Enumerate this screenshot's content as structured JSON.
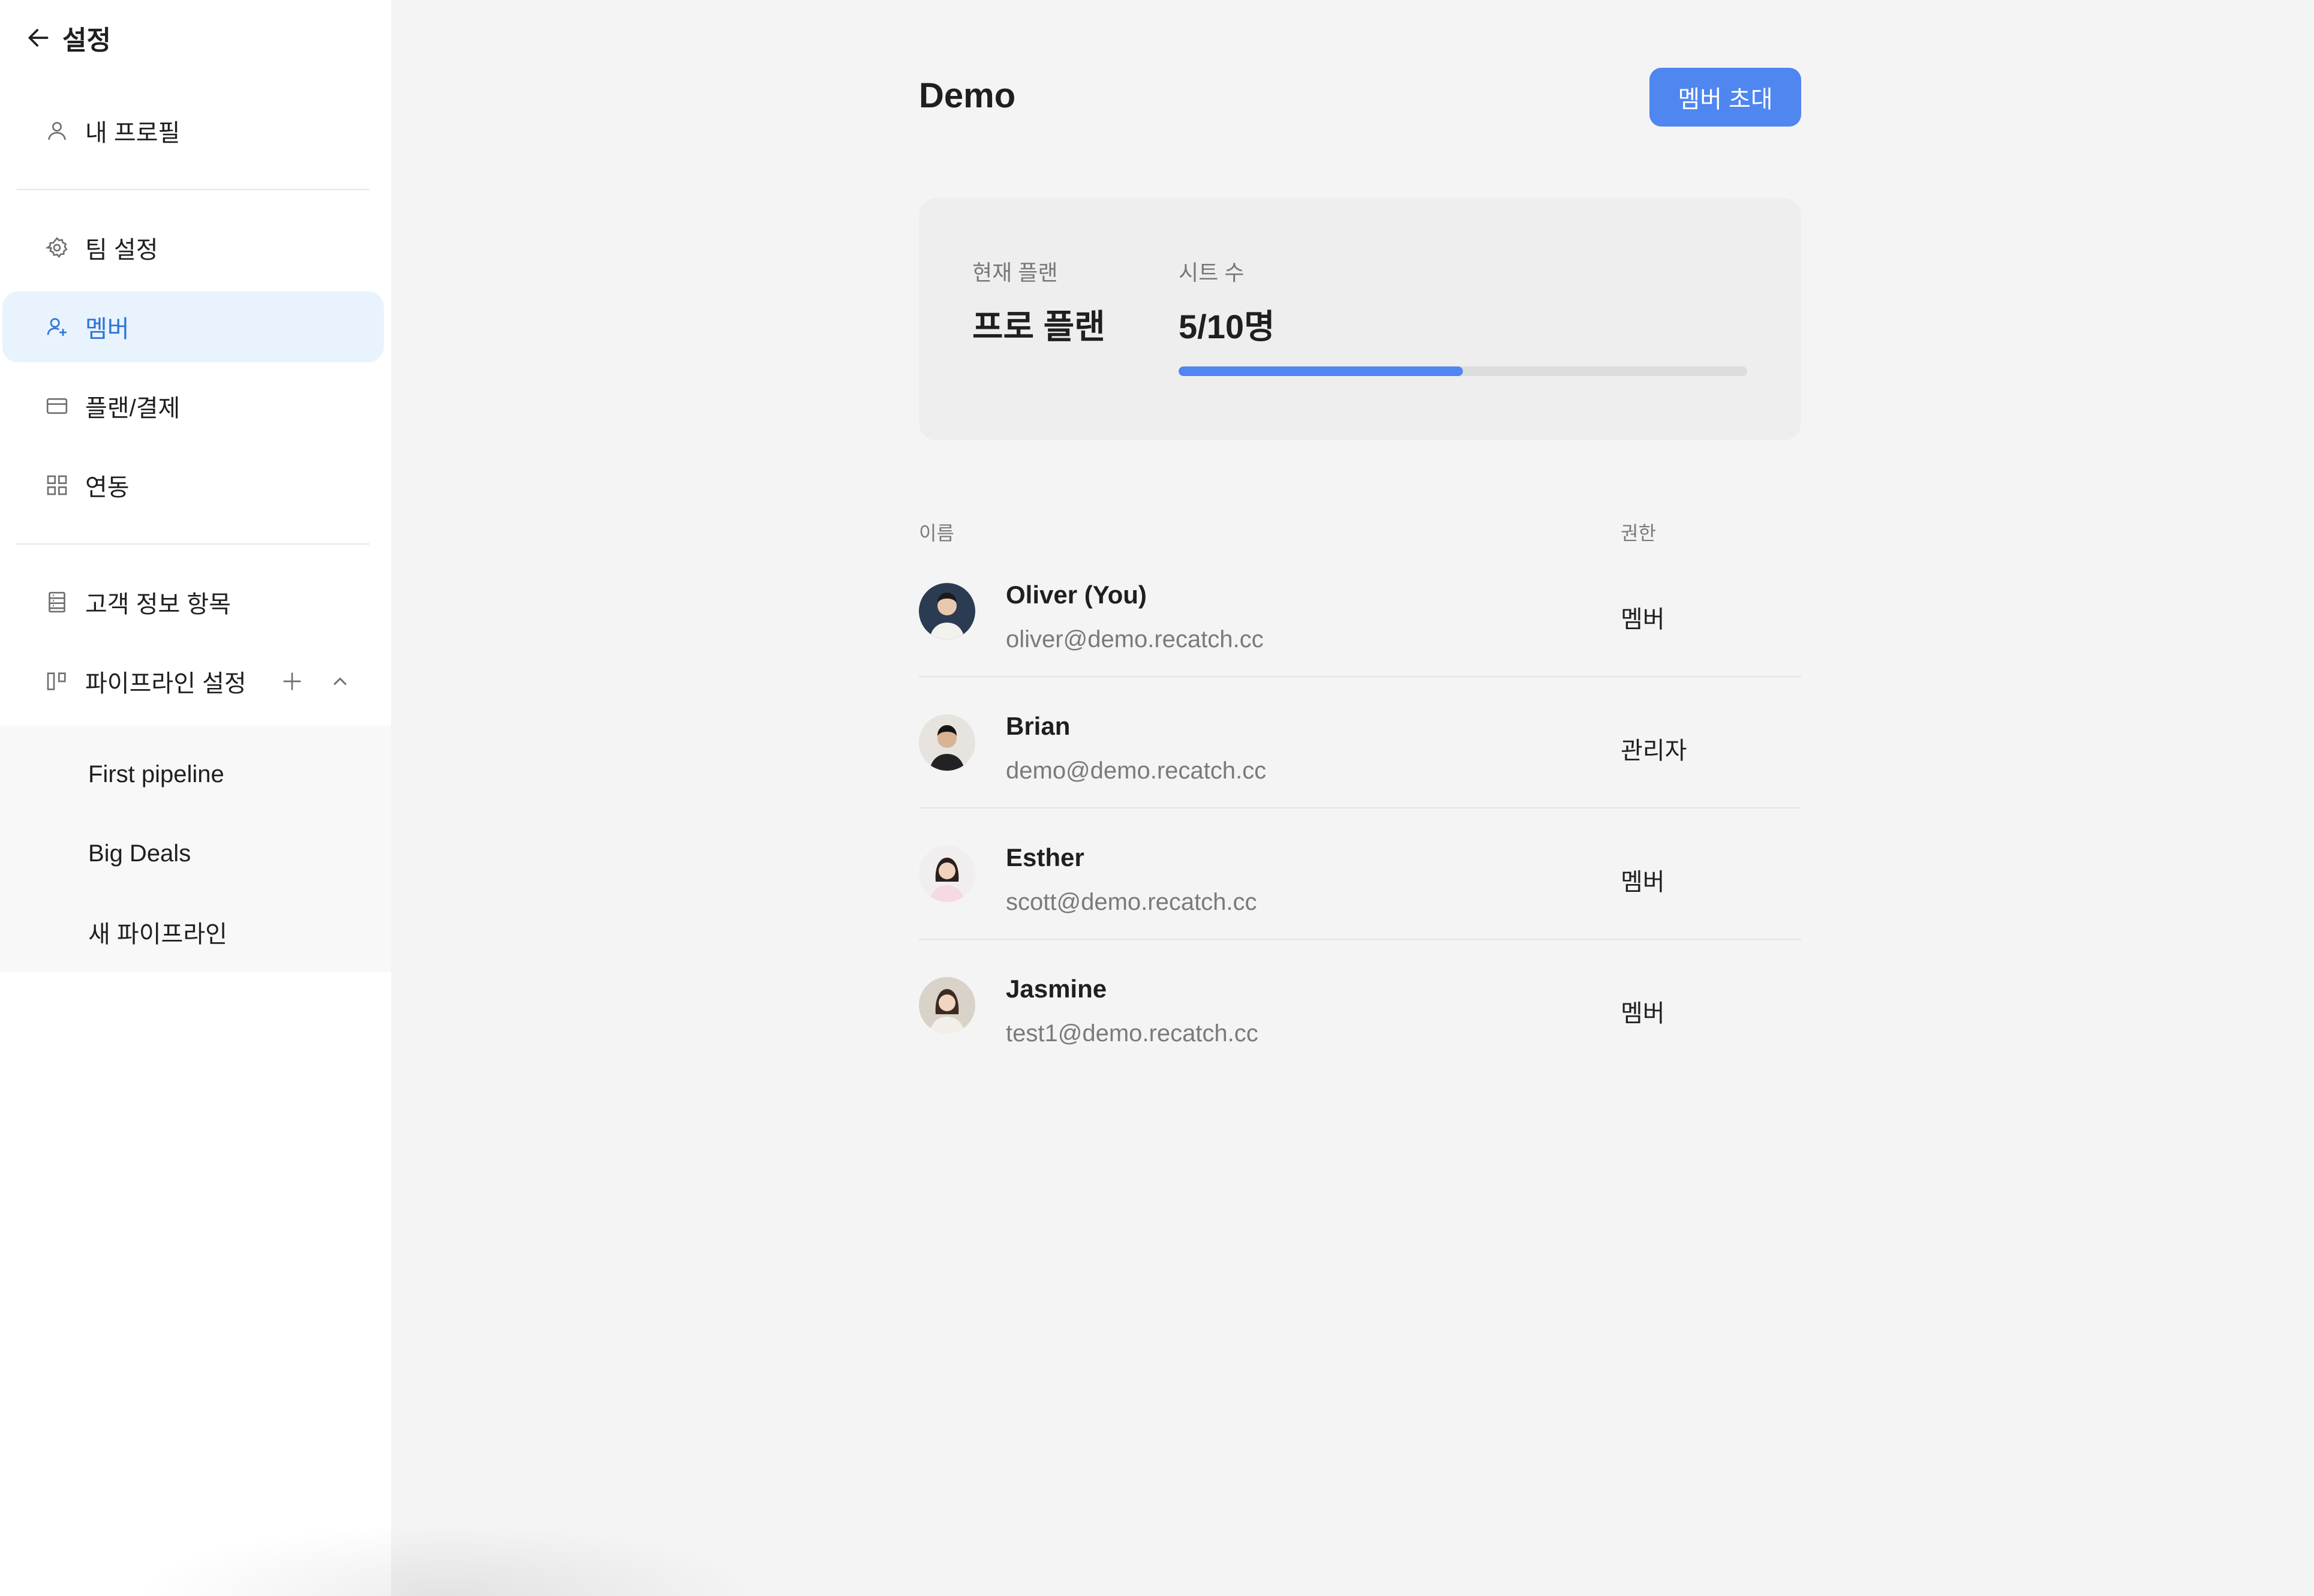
{
  "sidebar": {
    "title": "설정",
    "items": [
      {
        "label": "내 프로필",
        "icon": "user-icon"
      },
      {
        "label": "팀 설정",
        "icon": "gear-icon"
      },
      {
        "label": "멤버",
        "icon": "member-icon",
        "active": true
      },
      {
        "label": "플랜/결제",
        "icon": "card-icon"
      },
      {
        "label": "연동",
        "icon": "grid-icon"
      },
      {
        "label": "고객 정보 항목",
        "icon": "list-icon"
      },
      {
        "label": "파이프라인 설정",
        "icon": "pipeline-icon"
      }
    ],
    "pipelines": [
      "First pipeline",
      "Big Deals",
      "새 파이프라인"
    ]
  },
  "main": {
    "title": "Demo",
    "invite_label": "멤버 초대",
    "plan": {
      "current_label": "현재 플랜",
      "current_value": "프로 플랜",
      "seats_label": "시트 수",
      "seats_value": "5/10명",
      "seats_progress": 0.5
    },
    "table": {
      "col_name": "이름",
      "col_role": "권한",
      "members": [
        {
          "name": "Oliver (You)",
          "email": "oliver@demo.recatch.cc",
          "role": "멤버"
        },
        {
          "name": "Brian",
          "email": "demo@demo.recatch.cc",
          "role": "관리자"
        },
        {
          "name": "Esther",
          "email": "scott@demo.recatch.cc",
          "role": "멤버"
        },
        {
          "name": "Jasmine",
          "email": "test1@demo.recatch.cc",
          "role": "멤버"
        }
      ]
    }
  },
  "colors": {
    "accent": "#4f86f0",
    "active_bg": "#e8f3fd",
    "active_text": "#2c73d9"
  }
}
